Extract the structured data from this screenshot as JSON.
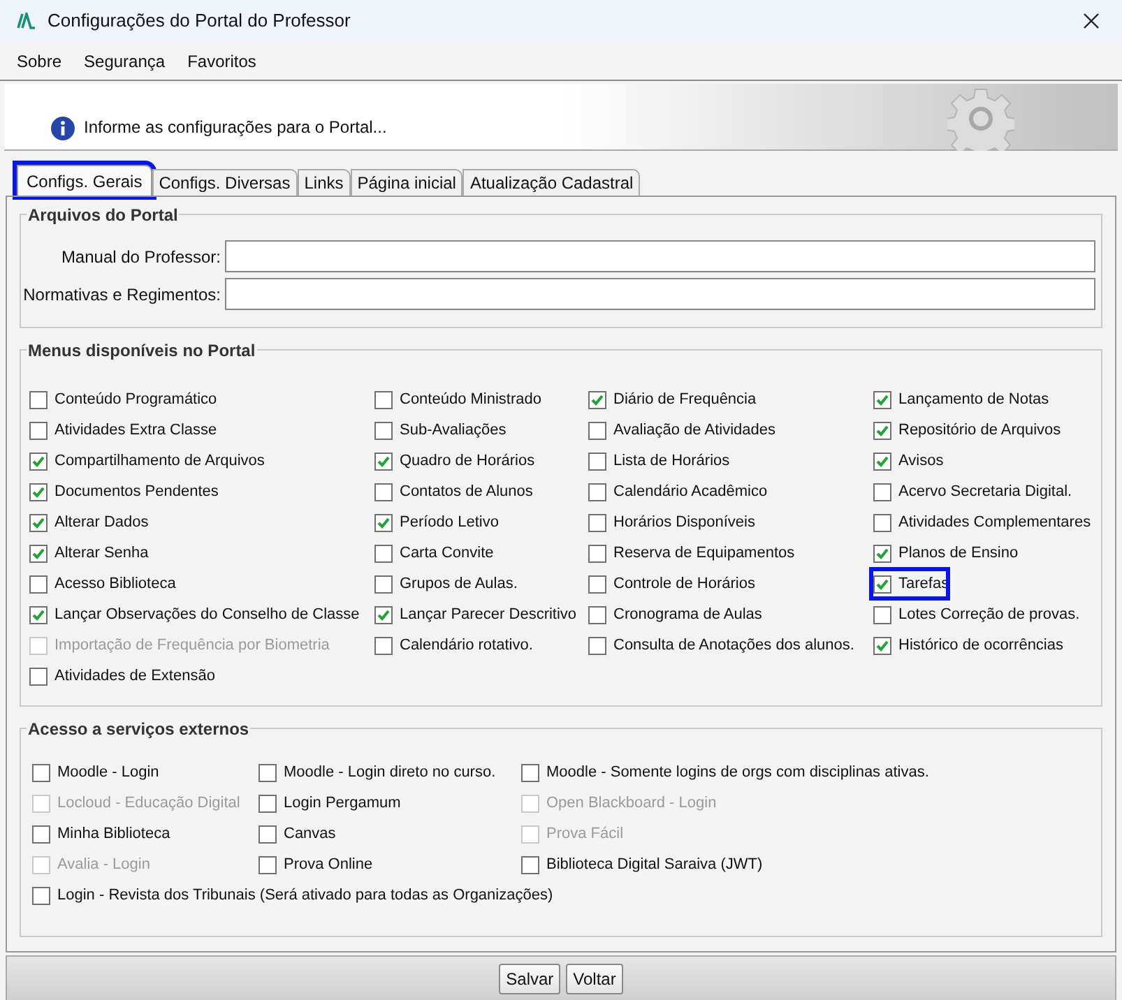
{
  "window": {
    "title": "Configurações do Portal do Professor"
  },
  "menu_bar": [
    "Sobre",
    "Segurança",
    "Favoritos"
  ],
  "banner": {
    "message": "Informe as configurações para o Portal..."
  },
  "tabs": [
    {
      "label": "Configs. Gerais",
      "selected": true,
      "highlighted": true
    },
    {
      "label": "Configs. Diversas",
      "selected": false,
      "highlighted": false
    },
    {
      "label": "Links",
      "selected": false,
      "highlighted": false
    },
    {
      "label": "Página inicial",
      "selected": false,
      "highlighted": false
    },
    {
      "label": "Atualização Cadastral",
      "selected": false,
      "highlighted": false
    }
  ],
  "arquivos": {
    "title": "Arquivos do Portal",
    "fields": [
      {
        "label": "Manual do Professor:"
      },
      {
        "label": "Normativas e Regimentos:"
      }
    ]
  },
  "menus": {
    "title": "Menus disponíveis no Portal",
    "items": [
      {
        "label": "Conteúdo Programático",
        "checked": false,
        "disabled": false,
        "highlighted": false
      },
      {
        "label": "Conteúdo Ministrado",
        "checked": false,
        "disabled": false,
        "highlighted": false
      },
      {
        "label": "Diário de Frequência",
        "checked": true,
        "disabled": false,
        "highlighted": false
      },
      {
        "label": "Lançamento de Notas",
        "checked": true,
        "disabled": false,
        "highlighted": false
      },
      {
        "label": "Atividades Extra Classe",
        "checked": false,
        "disabled": false,
        "highlighted": false
      },
      {
        "label": "Sub-Avaliações",
        "checked": false,
        "disabled": false,
        "highlighted": false
      },
      {
        "label": "Avaliação de Atividades",
        "checked": false,
        "disabled": false,
        "highlighted": false
      },
      {
        "label": "Repositório de Arquivos",
        "checked": true,
        "disabled": false,
        "highlighted": false
      },
      {
        "label": "Compartilhamento de Arquivos",
        "checked": true,
        "disabled": false,
        "highlighted": false
      },
      {
        "label": "Quadro de Horários",
        "checked": true,
        "disabled": false,
        "highlighted": false
      },
      {
        "label": "Lista de Horários",
        "checked": false,
        "disabled": false,
        "highlighted": false
      },
      {
        "label": "Avisos",
        "checked": true,
        "disabled": false,
        "highlighted": false
      },
      {
        "label": "Documentos Pendentes",
        "checked": true,
        "disabled": false,
        "highlighted": false
      },
      {
        "label": "Contatos de Alunos",
        "checked": false,
        "disabled": false,
        "highlighted": false
      },
      {
        "label": "Calendário Acadêmico",
        "checked": false,
        "disabled": false,
        "highlighted": false
      },
      {
        "label": "Acervo Secretaria Digital.",
        "checked": false,
        "disabled": false,
        "highlighted": false
      },
      {
        "label": "Alterar Dados",
        "checked": true,
        "disabled": false,
        "highlighted": false
      },
      {
        "label": "Período Letivo",
        "checked": true,
        "disabled": false,
        "highlighted": false
      },
      {
        "label": "Horários Disponíveis",
        "checked": false,
        "disabled": false,
        "highlighted": false
      },
      {
        "label": "Atividades Complementares",
        "checked": false,
        "disabled": false,
        "highlighted": false
      },
      {
        "label": "Alterar Senha",
        "checked": true,
        "disabled": false,
        "highlighted": false
      },
      {
        "label": "Carta Convite",
        "checked": false,
        "disabled": false,
        "highlighted": false
      },
      {
        "label": "Reserva de Equipamentos",
        "checked": false,
        "disabled": false,
        "highlighted": false
      },
      {
        "label": "Planos de Ensino",
        "checked": true,
        "disabled": false,
        "highlighted": false
      },
      {
        "label": "Acesso Biblioteca",
        "checked": false,
        "disabled": false,
        "highlighted": false
      },
      {
        "label": "Grupos de Aulas.",
        "checked": false,
        "disabled": false,
        "highlighted": false
      },
      {
        "label": "Controle de Horários",
        "checked": false,
        "disabled": false,
        "highlighted": false
      },
      {
        "label": "Tarefas",
        "checked": true,
        "disabled": false,
        "highlighted": true
      },
      {
        "label": "Lançar Observações do Conselho de Classe",
        "checked": true,
        "disabled": false,
        "highlighted": false
      },
      {
        "label": "Lançar Parecer Descritivo",
        "checked": true,
        "disabled": false,
        "highlighted": false
      },
      {
        "label": "Cronograma de Aulas",
        "checked": false,
        "disabled": false,
        "highlighted": false
      },
      {
        "label": "Lotes Correção de provas.",
        "checked": false,
        "disabled": false,
        "highlighted": false
      },
      {
        "label": "Importação de Frequência por Biometria",
        "checked": false,
        "disabled": true,
        "highlighted": false
      },
      {
        "label": "Calendário rotativo.",
        "checked": false,
        "disabled": false,
        "highlighted": false
      },
      {
        "label": "Consulta de Anotações dos alunos.",
        "checked": false,
        "disabled": false,
        "highlighted": false
      },
      {
        "label": "Histórico de ocorrências",
        "checked": true,
        "disabled": false,
        "highlighted": false
      },
      {
        "label": "Atividades de Extensão",
        "checked": false,
        "disabled": false,
        "highlighted": false
      }
    ]
  },
  "externos": {
    "title": "Acesso a serviços externos",
    "items": [
      {
        "label": "Moodle - Login",
        "checked": false,
        "disabled": false
      },
      {
        "label": "Moodle - Login direto no curso.",
        "checked": false,
        "disabled": false
      },
      {
        "label": "Moodle - Somente logins de orgs com disciplinas ativas.",
        "checked": false,
        "disabled": false
      },
      {
        "label": "Locloud - Educação Digital",
        "checked": false,
        "disabled": true
      },
      {
        "label": "Login Pergamum",
        "checked": false,
        "disabled": false
      },
      {
        "label": "Open Blackboard - Login",
        "checked": false,
        "disabled": true
      },
      {
        "label": "Minha Biblioteca",
        "checked": false,
        "disabled": false
      },
      {
        "label": "Canvas",
        "checked": false,
        "disabled": false
      },
      {
        "label": "Prova Fácil",
        "checked": false,
        "disabled": true
      },
      {
        "label": "Avalia - Login",
        "checked": false,
        "disabled": true
      },
      {
        "label": "Prova Online",
        "checked": false,
        "disabled": false
      },
      {
        "label": "Biblioteca Digital Saraiva (JWT)",
        "checked": false,
        "disabled": false
      },
      {
        "label": "Login - Revista dos Tribunais (Será ativado para todas as Organizações)",
        "checked": false,
        "disabled": false
      }
    ]
  },
  "buttons": [
    "Salvar",
    "Voltar"
  ]
}
